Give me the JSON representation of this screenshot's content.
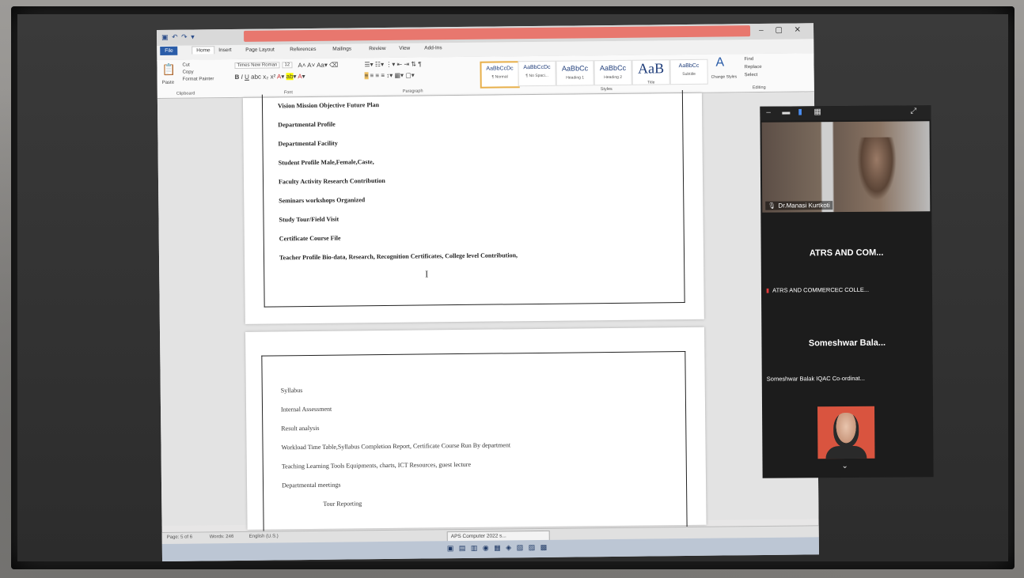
{
  "word": {
    "tabs": [
      "File",
      "Home",
      "Insert",
      "Page Layout",
      "References",
      "Mailings",
      "Review",
      "View",
      "Add-Ins"
    ],
    "ribbon": {
      "paste_label": "Paste",
      "cut_label": "Cut",
      "copy_label": "Copy",
      "format_painter_label": "Format Painter",
      "clipboard_label": "Clipboard",
      "font_name": "Times New Roman",
      "font_size": "12",
      "font_label": "Font",
      "paragraph_label": "Paragraph",
      "styles_label": "Styles",
      "editing_label": "Editing",
      "change_styles_label": "Change Styles",
      "find_label": "Find",
      "replace_label": "Replace",
      "select_label": "Select",
      "styles": [
        {
          "sample": "AaBbCcDc",
          "name": "¶ Normal",
          "selected": true
        },
        {
          "sample": "AaBbCcDc",
          "name": "¶ No Spaci...",
          "selected": false
        },
        {
          "sample": "AaBbCc",
          "name": "Heading 1",
          "selected": false
        },
        {
          "sample": "AaBbCc",
          "name": "Heading 2",
          "selected": false
        },
        {
          "sample": "AaB",
          "name": "Title",
          "selected": false
        },
        {
          "sample": "AaBbCc",
          "name": "Subtitle",
          "selected": false
        }
      ]
    },
    "page1_lines": [
      "Vision Mission Objective Future Plan",
      "Departmental Profile",
      "Departmental Facility",
      "Student Profile Male,Female,Caste,",
      "Faculty Activity Research Contribution",
      "Seminars workshops Organized",
      "Study Tour/Field Visit",
      "Certificate Course File",
      "Teacher Profile Bio-data, Research, Recognition Certificates, College level Contribution,"
    ],
    "page2_lines": [
      "Syllabus",
      "Internal Assessment",
      "Result analysis",
      "Workload Time Table,Syllabus Completion Report, Certificate Course Run By department",
      "Teaching Learning Tools Equipments, charts, ICT Resources, guest lecture",
      "Departmental meetings",
      "Tour Reporting"
    ],
    "status": {
      "page": "Page: 5 of 6",
      "words": "Words: 246",
      "language": "English (U.S.)"
    },
    "taskbar_popup": "APS Computer 2022 s..."
  },
  "zoom": {
    "participants": [
      {
        "name": "Dr.Manasi Kurtkoti",
        "type": "video"
      },
      {
        "big_name": "ATRS AND COM...",
        "name": "ATRS AND COMMERCEC COLLE...",
        "muted": true
      },
      {
        "big_name": "Someshwar Bala...",
        "name": "Someshwar Balak IQAC Co-ordinat...",
        "muted": false
      }
    ]
  },
  "colors": {
    "title_bar_accent": "#e8776e",
    "file_tab": "#2a5ca8",
    "zoom_panel": "#1c1c1c",
    "avatar_bg": "#d9543f"
  }
}
